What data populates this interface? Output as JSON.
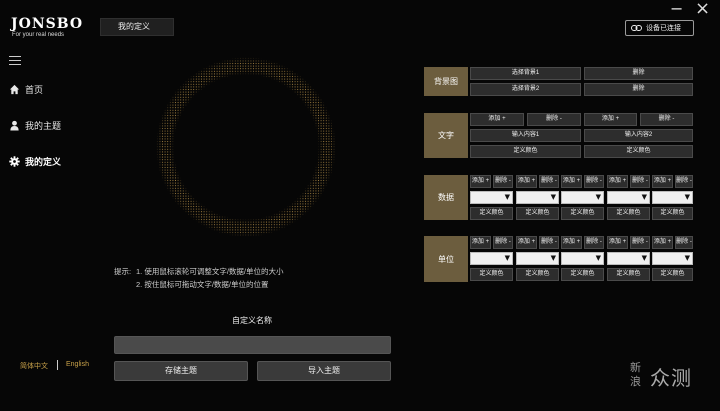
{
  "header": {
    "brand": "JONSBO",
    "tagline": "For your real needs",
    "page_tab": "我的定义",
    "minimize": "−",
    "close": "×",
    "connect_status": "设备已连接"
  },
  "sidebar": {
    "items": [
      {
        "label": "首页",
        "icon": "home-icon"
      },
      {
        "label": "我的主题",
        "icon": "user-icon"
      },
      {
        "label": "我的定义",
        "icon": "gear-icon"
      }
    ],
    "lang_zh": "简体中文",
    "lang_en": "English"
  },
  "hints": {
    "prefix": "提示:",
    "line1": "1. 使用鼠标滚轮可调整文字/数据/单位的大小",
    "line2": "2. 按住鼠标可拖动文字/数据/单位的位置"
  },
  "theme": {
    "name_label": "自定义名称",
    "name_value": "",
    "save_label": "存储主题",
    "import_label": "导入主题"
  },
  "panel": {
    "background": {
      "label": "背景图",
      "select1": "选择背景1",
      "select2": "选择背景2",
      "delete": "删除"
    },
    "text": {
      "label": "文字",
      "add": "添加 +",
      "remove": "删除 -",
      "input1": "输入内容1",
      "input2": "输入内容2",
      "color": "定义颜色"
    },
    "data": {
      "label": "数据",
      "add": "添加 +",
      "remove": "删除 -",
      "color": "定义颜色"
    },
    "unit": {
      "label": "单位",
      "add": "添加 +",
      "remove": "删除 -",
      "color": "定义颜色"
    }
  },
  "watermark": {
    "line1": "新",
    "line2": "浪",
    "word": "众测"
  },
  "colors": {
    "section_accent": "#6c5d3e",
    "lang_active": "#c9a24a",
    "background": "#060606"
  }
}
